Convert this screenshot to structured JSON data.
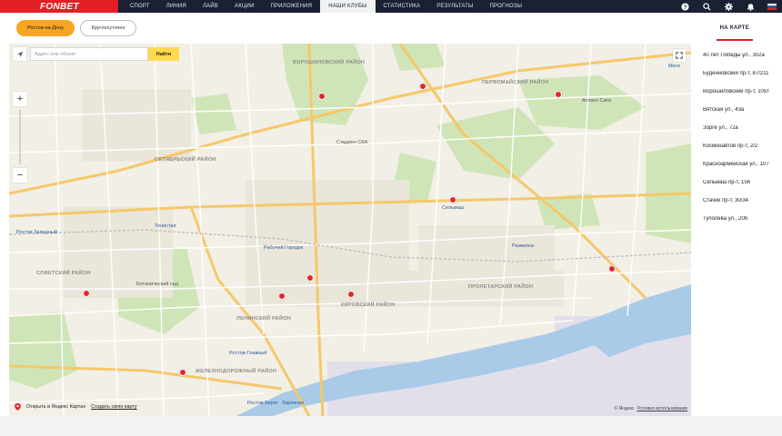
{
  "brand": {
    "logo_text": "FONBET",
    "logo_color": "#e31e24",
    "nav_bg": "#1a2133"
  },
  "nav": {
    "items": [
      {
        "label": "СПОРТ"
      },
      {
        "label": "ЛИНИЯ"
      },
      {
        "label": "ЛАЙВ"
      },
      {
        "label": "АКЦИИ"
      },
      {
        "label": "ПРИЛОЖЕНИЯ"
      },
      {
        "label": "НАШИ КЛУБЫ",
        "active": true
      },
      {
        "label": "СТАТИСТИКА"
      },
      {
        "label": "РЕЗУЛЬТАТЫ"
      },
      {
        "label": "ПРОГНОЗЫ"
      }
    ],
    "icons": [
      "help-icon",
      "search-icon",
      "settings-icon",
      "notifications-icon",
      "russia-flag-icon"
    ]
  },
  "filters": {
    "city": "Ростов-на-Дону",
    "hours": "Круглосуточно"
  },
  "tabs": {
    "map_tab": "НА КАРТЕ"
  },
  "map": {
    "search_placeholder": "Адрес или объект",
    "search_button": "Найти",
    "open_yandex": "Открыть в Яндекс Картах",
    "create_map": "Создать свою карту",
    "copyright": "© Яндекс",
    "terms": "Условия использования",
    "districts": [
      "ВОРОШИЛОВСКИЙ РАЙОН",
      "ПЕРВОМАЙСКИЙ РАЙОН",
      "ОКТЯБРЬСКИЙ РАЙОН",
      "СОВЕТСКИЙ РАЙОН",
      "ЛЕНИНСКИЙ РАЙОН",
      "КИРОВСКИЙ РАЙОН",
      "ПРОЛЕТАРСКИЙ РАЙОН",
      "ЖЕЛЕЗНОДОРОЖНЫЙ РАЙОН"
    ],
    "places": [
      "Ростов Западный",
      "Стадион СКА",
      "Тенистая",
      "Рабочий Городок",
      "Ростов-Главный",
      "Ботанический сад",
      "Сельмаш",
      "Развилка",
      "Ростов Берег",
      "Заречная",
      "Атлант-Сити",
      "Меги",
      "Ботанический сад"
    ]
  },
  "addresses": [
    "40 лет Победы ул., 302а",
    "Буденновский пр-т, 87/211",
    "Ворошиловский пр-т, 105т",
    "Вятская ул., 43а",
    "Зорге ул., 72а",
    "Космонавтов пр-т, 2/2",
    "Красноармейская ул., 107",
    "Сельмаш пр-т, 156",
    "Стачки пр-т, 30/34",
    "Туполева ул., 20б"
  ]
}
